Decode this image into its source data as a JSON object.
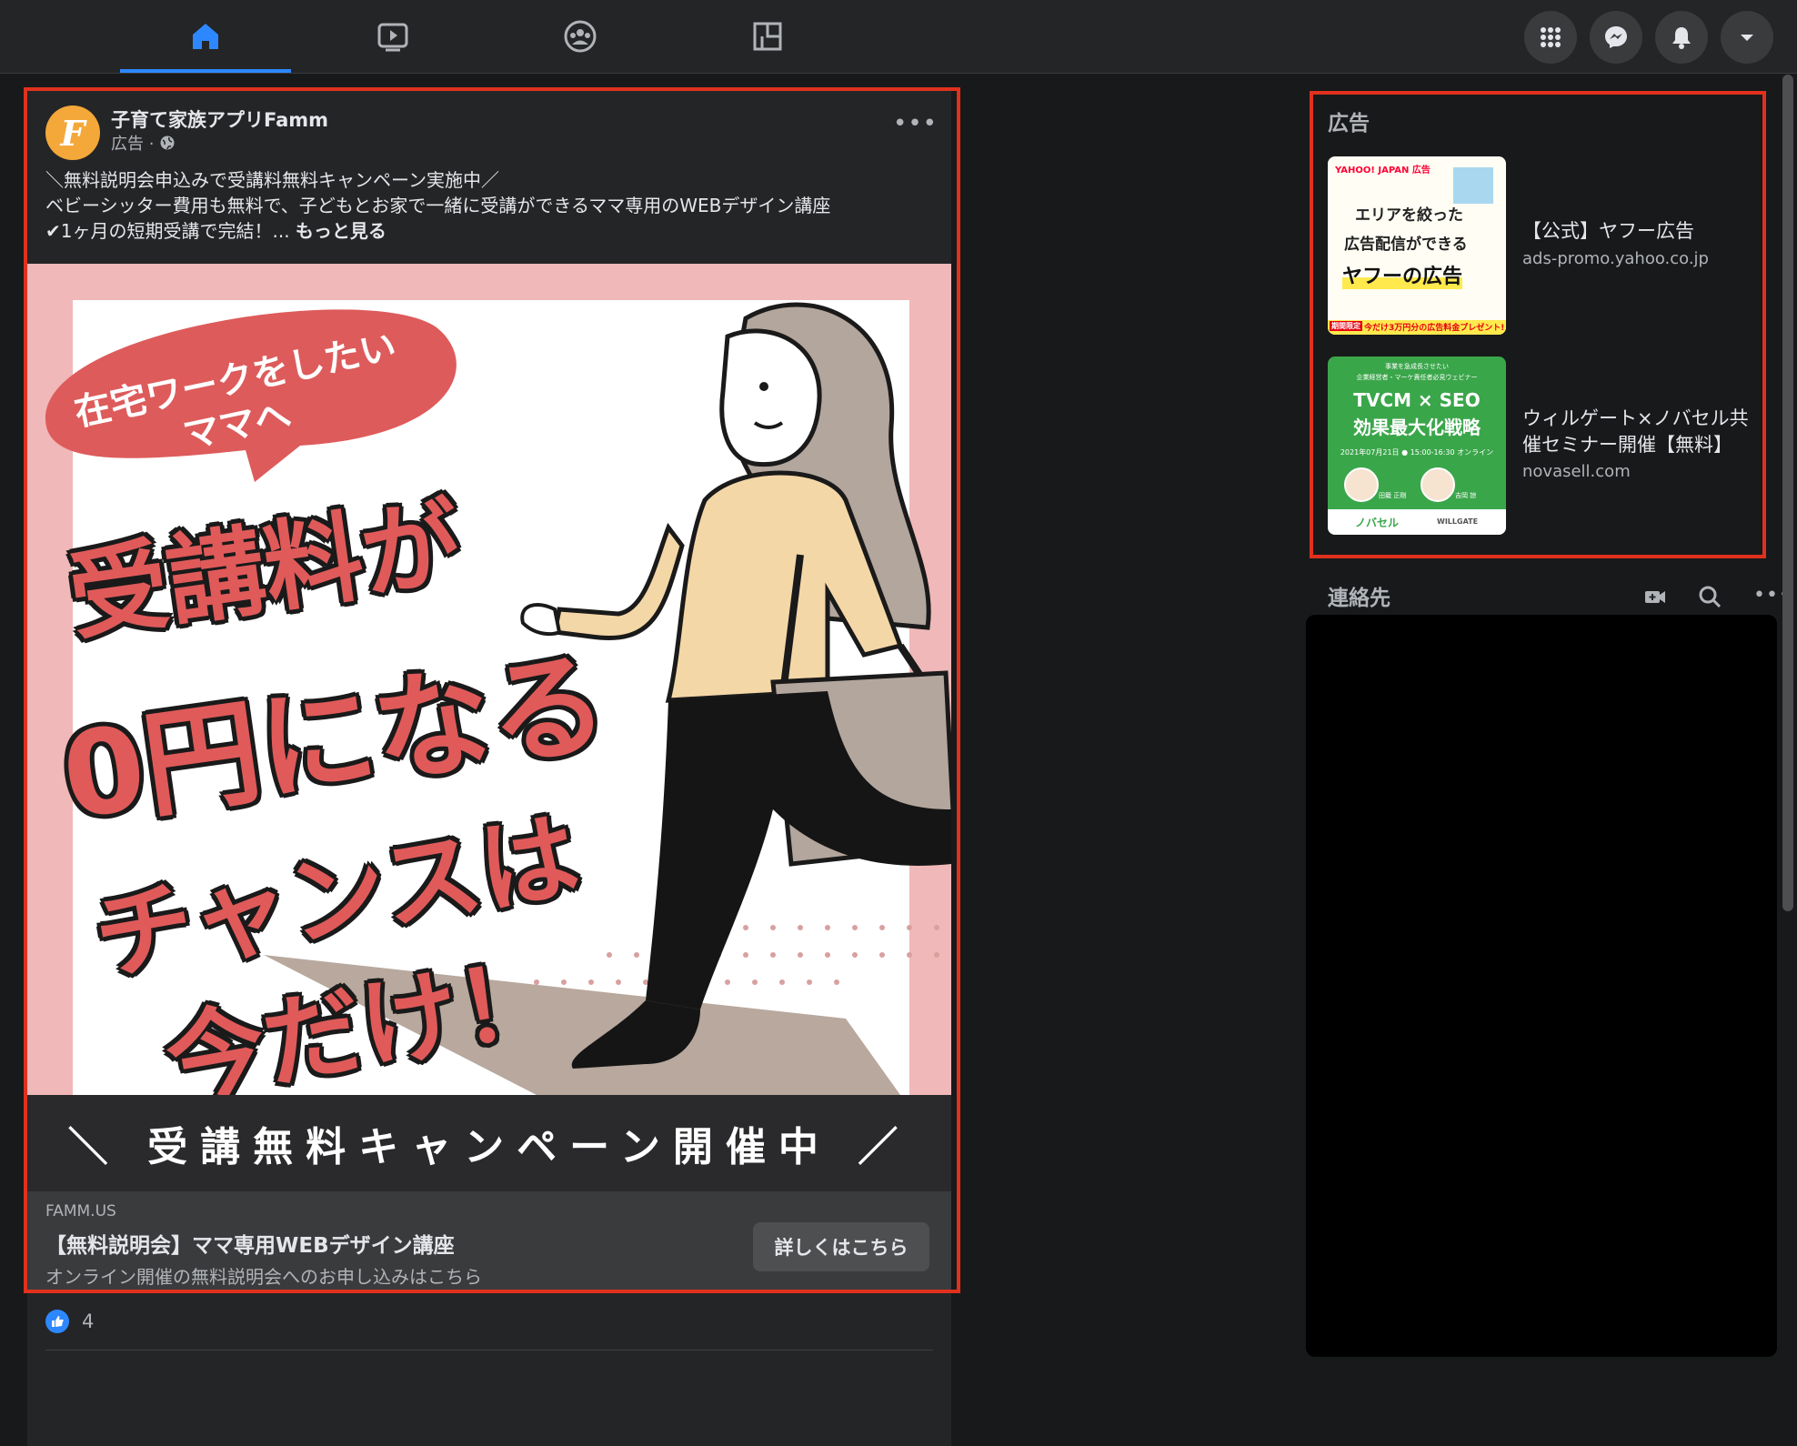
{
  "nav": {
    "tabs": [
      {
        "name": "home",
        "active": true
      },
      {
        "name": "watch",
        "active": false
      },
      {
        "name": "groups",
        "active": false
      },
      {
        "name": "gaming",
        "active": false
      }
    ],
    "right_buttons": [
      "menu-grid-icon",
      "messenger-icon",
      "notifications-bell-icon",
      "account-dropdown-icon"
    ]
  },
  "post": {
    "page_name": "子育て家族アプリFamm",
    "avatar_letter": "F",
    "sponsored_label": "広告 ·",
    "text_lines": [
      "＼無料説明会申込みで受講料無料キャンペーン実施中／",
      "ベビーシッター費用も無料で、子どもとお家で一緒に受講ができるママ専用のWEBデザイン講座",
      "✔︎1ヶ月の短期受講で完結！... "
    ],
    "see_more": "もっと見る",
    "creative": {
      "bubble_line1": "在宅ワークをしたい",
      "bubble_line2": "ママへ",
      "headline1": "受講料が",
      "headline2": "0円になる",
      "headline3": "チャンスは",
      "headline4": "今だけ！",
      "banner": "＼ 受講無料キャンペーン開催中 ／"
    },
    "link": {
      "domain": "FAMM.US",
      "title": "【無料説明会】ママ専用WEBデザイン講座",
      "description": "オンライン開催の無料説明会へのお申し込みはこちら",
      "cta_label": "詳しくはこちら"
    },
    "like_count": "4"
  },
  "sidebar": {
    "ads_title": "広告",
    "ads": [
      {
        "title": "【公式】ヤフー広告",
        "url": "ads-promo.yahoo.co.jp",
        "thumb_logo": "YAHOO! JAPAN 広告",
        "thumb_line1": "エリアを絞った",
        "thumb_line2": "広告配信ができる",
        "thumb_line3": "ヤフーの広告",
        "thumb_tag": "期間限定",
        "thumb_footer": "今だけ3万円分の広告料金プレゼント!"
      },
      {
        "title": "ウィルゲート×ノバセル共催セミナー開催【無料】",
        "url": "novasell.com",
        "thumb_top1": "事業を急成長させたい",
        "thumb_top2": "企業経営者・マーケ責任者必見ウェビナー",
        "thumb_line1": "TVCM × SEO",
        "thumb_line2": "効果最大化戦略",
        "thumb_date": "2021年07月21日 ● 15:00-16:30 オンライン",
        "thumb_person1": "田籠 正剛",
        "thumb_person2": "吉岡 諒",
        "thumb_brand1": "ノバセル",
        "thumb_brand2": "WILLGATE"
      }
    ],
    "contacts_title": "連絡先"
  },
  "colors": {
    "background": "#18191a",
    "card": "#242526",
    "accent": "#2d88ff",
    "highlight_outline": "#e0311e",
    "creative_pink": "#f0b8b8",
    "creative_red": "#e05a5a"
  }
}
